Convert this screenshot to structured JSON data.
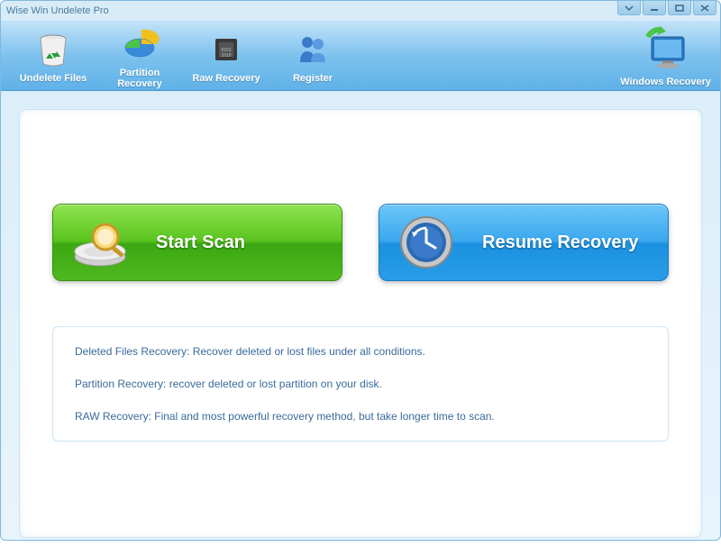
{
  "window": {
    "title": "Wise Win Undelete Pro"
  },
  "toolbar": {
    "items": [
      {
        "label": "Undelete Files"
      },
      {
        "label": "Partition Recovery"
      },
      {
        "label": "Raw Recovery"
      },
      {
        "label": "Register"
      }
    ],
    "right_label": "Windows Recovery"
  },
  "buttons": {
    "scan": "Start  Scan",
    "resume": "Resume Recovery"
  },
  "info": {
    "line1": "Deleted Files Recovery: Recover deleted or lost files  under all conditions.",
    "line2": "Partition Recovery: recover deleted or lost partition on your disk.",
    "line3": "RAW Recovery: Final and most powerful recovery method, but take longer time to scan."
  }
}
